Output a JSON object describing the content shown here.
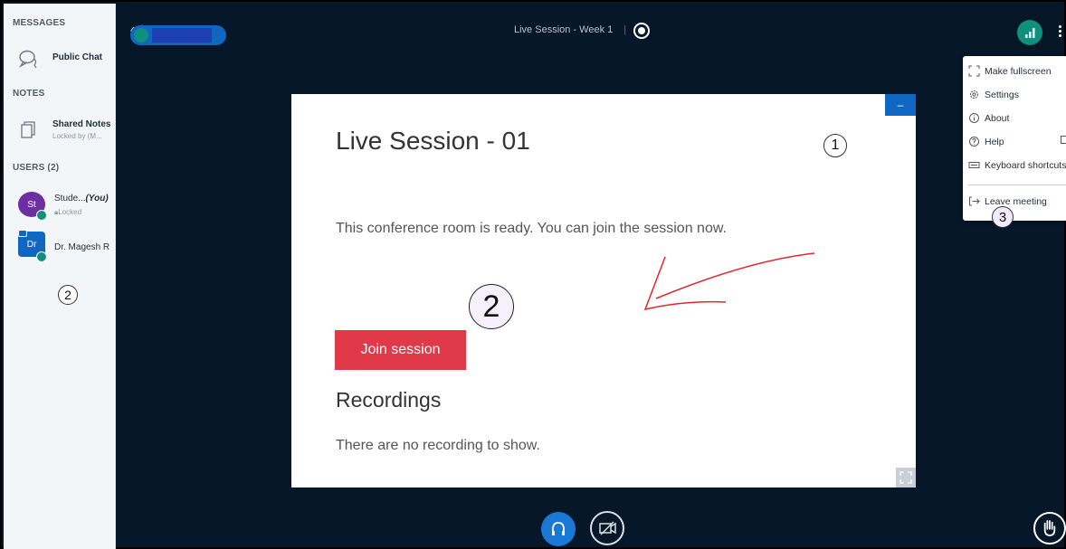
{
  "sidebar": {
    "messages_title": "MESSAGES",
    "public_chat_label": "Public Chat",
    "notes_title": "NOTES",
    "shared_notes_label": "Shared Notes",
    "shared_notes_sub": "Locked by (M...",
    "users_title": "USERS (2)",
    "users": [
      {
        "initials": "St",
        "name": "Stude...",
        "you": "(You)",
        "sub": "Locked",
        "color": "#6b2fa3"
      },
      {
        "initials": "Dr",
        "name": "Dr. Magesh R",
        "color": "#0f67c2"
      }
    ],
    "annotation": "2"
  },
  "topbar": {
    "title": "Live Session - Week 1"
  },
  "presentation": {
    "minimize_label": "–",
    "title": "Live Session - 01",
    "message": "This conference room is ready. You can join the session now.",
    "join_label": "Join session",
    "recordings_title": "Recordings",
    "recordings_message": "There are no recording to show.",
    "annotation_1": "1",
    "annotation_2": "2"
  },
  "menu": {
    "items": [
      {
        "label": "Make fullscreen",
        "icon": "fullscreen-icon"
      },
      {
        "label": "Settings",
        "icon": "gear-icon"
      },
      {
        "label": "About",
        "icon": "info-icon"
      },
      {
        "label": "Help",
        "icon": "help-icon"
      },
      {
        "label": "Keyboard shortcuts",
        "icon": "keyboard-icon"
      },
      {
        "label": "Leave meeting",
        "icon": "leave-icon"
      }
    ],
    "annotation": "3"
  },
  "colors": {
    "background": "#06172a",
    "primary": "#0f67c2",
    "join": "#e0394a",
    "status_green": "#0f8f7d"
  }
}
